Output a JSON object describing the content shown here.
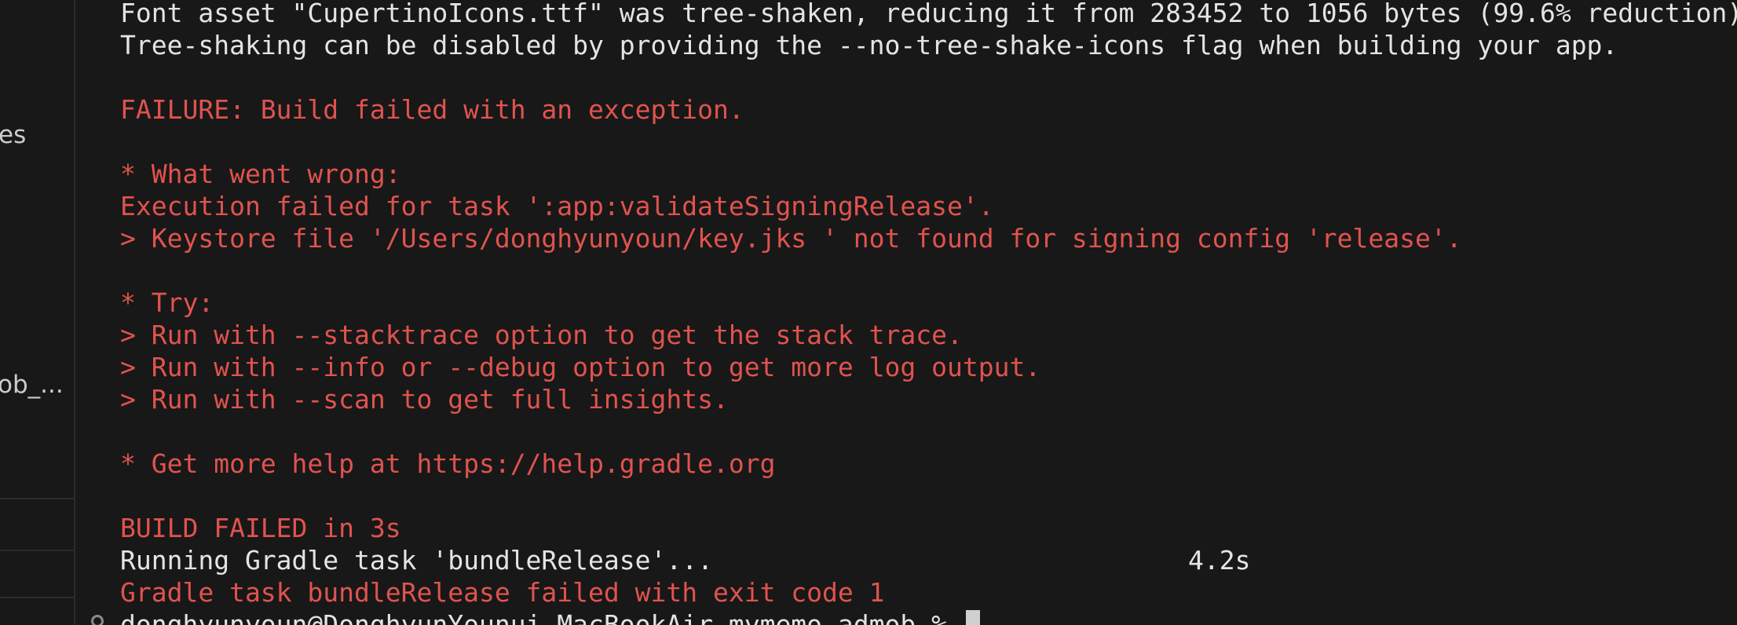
{
  "sidebar": {
    "items": [
      {
        "label": "es"
      },
      {
        "label": "ob_..."
      }
    ]
  },
  "terminal": {
    "lines": [
      {
        "text": "Font asset \"CupertinoIcons.ttf\" was tree-shaken, reducing it from 283452 to 1056 bytes (99.6% reduction)",
        "kind": "normal"
      },
      {
        "text": "Tree-shaking can be disabled by providing the --no-tree-shake-icons flag when building your app.",
        "kind": "normal"
      },
      {
        "text": "",
        "kind": "blank"
      },
      {
        "text": "FAILURE: Build failed with an exception.",
        "kind": "error"
      },
      {
        "text": "",
        "kind": "blank"
      },
      {
        "text": "* What went wrong:",
        "kind": "error"
      },
      {
        "text": "Execution failed for task ':app:validateSigningRelease'.",
        "kind": "error"
      },
      {
        "text": "> Keystore file '/Users/donghyunyoun/key.jks ' not found for signing config 'release'.",
        "kind": "error"
      },
      {
        "text": "",
        "kind": "blank"
      },
      {
        "text": "* Try:",
        "kind": "error"
      },
      {
        "text": "> Run with --stacktrace option to get the stack trace.",
        "kind": "error"
      },
      {
        "text": "> Run with --info or --debug option to get more log output.",
        "kind": "error"
      },
      {
        "text": "> Run with --scan to get full insights.",
        "kind": "error"
      },
      {
        "text": "",
        "kind": "blank"
      },
      {
        "text": "* Get more help at https://help.gradle.org",
        "kind": "error"
      },
      {
        "text": "",
        "kind": "blank"
      },
      {
        "text": "BUILD FAILED in 3s",
        "kind": "error"
      },
      {
        "text": "Running Gradle task 'bundleRelease'...",
        "kind": "normal"
      },
      {
        "text": "Gradle task bundleRelease failed with exit code 1",
        "kind": "error"
      }
    ],
    "timing": "4.2s",
    "prompt": "donghyunyoun@DonghyunYounui-MacBookAir mymemo_admob % "
  },
  "colors": {
    "background": "#181818",
    "text": "#e4e4e4",
    "error": "#e0534e"
  },
  "icons": {
    "prompt_marker": "circle-icon",
    "cursor": "block-cursor-icon"
  }
}
